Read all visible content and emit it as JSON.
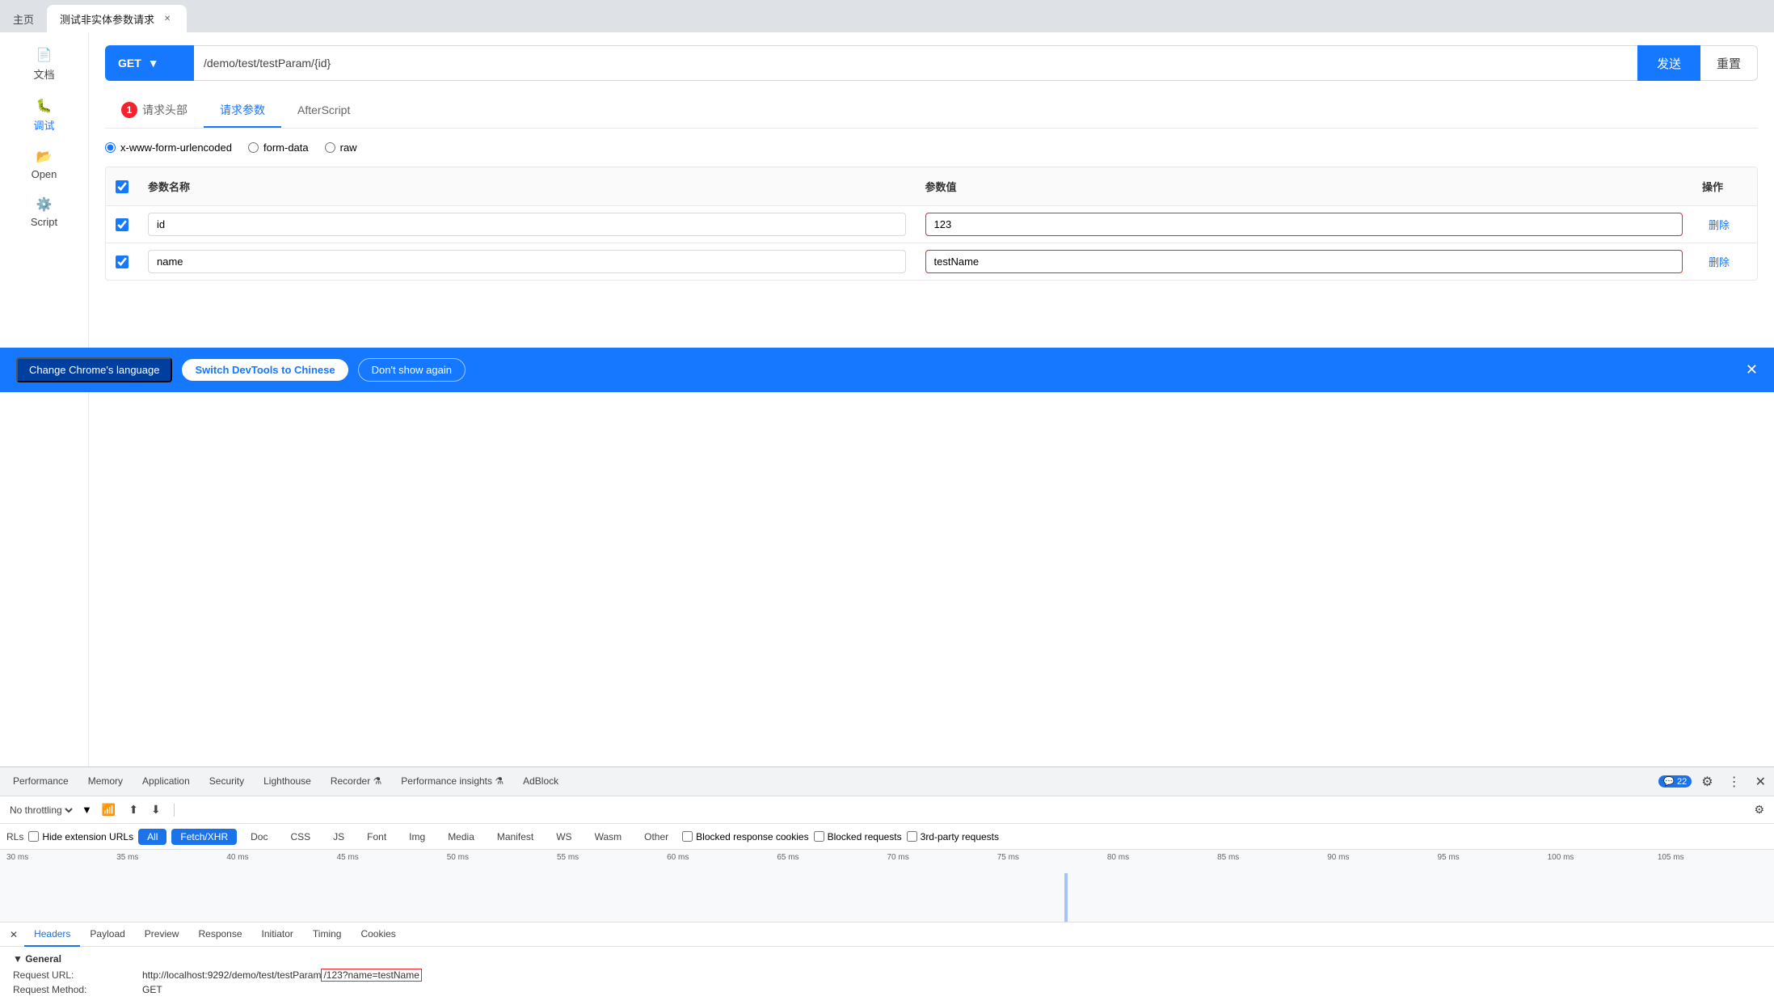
{
  "browser": {
    "tabs": [
      {
        "id": "home",
        "label": "主页",
        "active": false
      },
      {
        "id": "test",
        "label": "测试非实体参数请求",
        "active": true,
        "closable": true
      }
    ]
  },
  "sidebar": {
    "items": [
      {
        "id": "docs",
        "icon": "📄",
        "label": "文档"
      },
      {
        "id": "debug",
        "icon": "🐛",
        "label": "调试",
        "active": true
      },
      {
        "id": "open",
        "icon": "📂",
        "label": "Open"
      },
      {
        "id": "script",
        "icon": "⚙️",
        "label": "Script"
      }
    ]
  },
  "request": {
    "method": "GET",
    "url": "/demo/test/testParam/{id}",
    "send_label": "发送",
    "reset_label": "重置",
    "tabs": [
      {
        "id": "headers",
        "label": "请求头部",
        "badge": 1
      },
      {
        "id": "params",
        "label": "请求参数",
        "active": true
      },
      {
        "id": "afterscript",
        "label": "AfterScript"
      }
    ],
    "body_types": [
      {
        "id": "urlencoded",
        "label": "x-www-form-urlencoded",
        "checked": true
      },
      {
        "id": "formdata",
        "label": "form-data",
        "checked": false
      },
      {
        "id": "raw",
        "label": "raw",
        "checked": false
      }
    ],
    "table": {
      "columns": [
        "",
        "参数名称",
        "参数值",
        "操作"
      ],
      "rows": [
        {
          "checked": true,
          "name": "id",
          "value": "123",
          "highlighted": true,
          "action": "删除"
        },
        {
          "checked": true,
          "name": "name",
          "value": "testName",
          "highlighted": true,
          "action": "删除"
        }
      ]
    }
  },
  "notification": {
    "dark_text": "Change Chrome's language",
    "switch_label": "Switch DevTools to Chinese",
    "dont_show_label": "Don't show again"
  },
  "devtools": {
    "tabs": [
      {
        "id": "performance",
        "label": "Performance"
      },
      {
        "id": "memory",
        "label": "Memory"
      },
      {
        "id": "application",
        "label": "Application"
      },
      {
        "id": "security",
        "label": "Security"
      },
      {
        "id": "lighthouse",
        "label": "Lighthouse"
      },
      {
        "id": "recorder",
        "label": "Recorder",
        "icon": "⚗"
      },
      {
        "id": "perf-insights",
        "label": "Performance insights",
        "icon": "⚗"
      },
      {
        "id": "adblock",
        "label": "AdBlock"
      }
    ],
    "badge": "22"
  },
  "network": {
    "throttle": "No throttling",
    "filter_btns": [
      "All",
      "Fetch/XHR",
      "Doc",
      "CSS",
      "JS",
      "Font",
      "Img",
      "Media",
      "Manifest",
      "WS",
      "Wasm",
      "Other"
    ],
    "active_filter": "Fetch/XHR",
    "checkboxes": [
      {
        "id": "hide-ext",
        "label": "Hide extension URLs"
      },
      {
        "id": "blocked-cookies",
        "label": "Blocked response cookies"
      },
      {
        "id": "blocked-req",
        "label": "Blocked requests"
      },
      {
        "id": "third-party",
        "label": "3rd-party requests"
      }
    ],
    "filter_prefix": "RLs",
    "timeline_markers": [
      "30 ms",
      "35 ms",
      "40 ms",
      "45 ms",
      "50 ms",
      "55 ms",
      "60 ms",
      "65 ms",
      "70 ms",
      "75 ms",
      "80 ms",
      "85 ms",
      "90 ms",
      "95 ms",
      "100 ms",
      "105 ms"
    ]
  },
  "bottom_panel": {
    "tabs": [
      {
        "id": "close-btn",
        "label": "✕",
        "is_close": true
      },
      {
        "id": "headers",
        "label": "Headers",
        "active": true
      },
      {
        "id": "payload",
        "label": "Payload"
      },
      {
        "id": "preview",
        "label": "Preview"
      },
      {
        "id": "response",
        "label": "Response"
      },
      {
        "id": "initiator",
        "label": "Initiator"
      },
      {
        "id": "timing",
        "label": "Timing"
      },
      {
        "id": "cookies",
        "label": "Cookies"
      }
    ],
    "general": {
      "title": "▼ General",
      "rows": [
        {
          "key": "Request URL:",
          "value": "http://localhost:9292/demo/test/testParam/123?name=testName",
          "highlight_part": "/123?name=testName"
        },
        {
          "key": "Request Method:",
          "value": "GET"
        }
      ]
    }
  }
}
